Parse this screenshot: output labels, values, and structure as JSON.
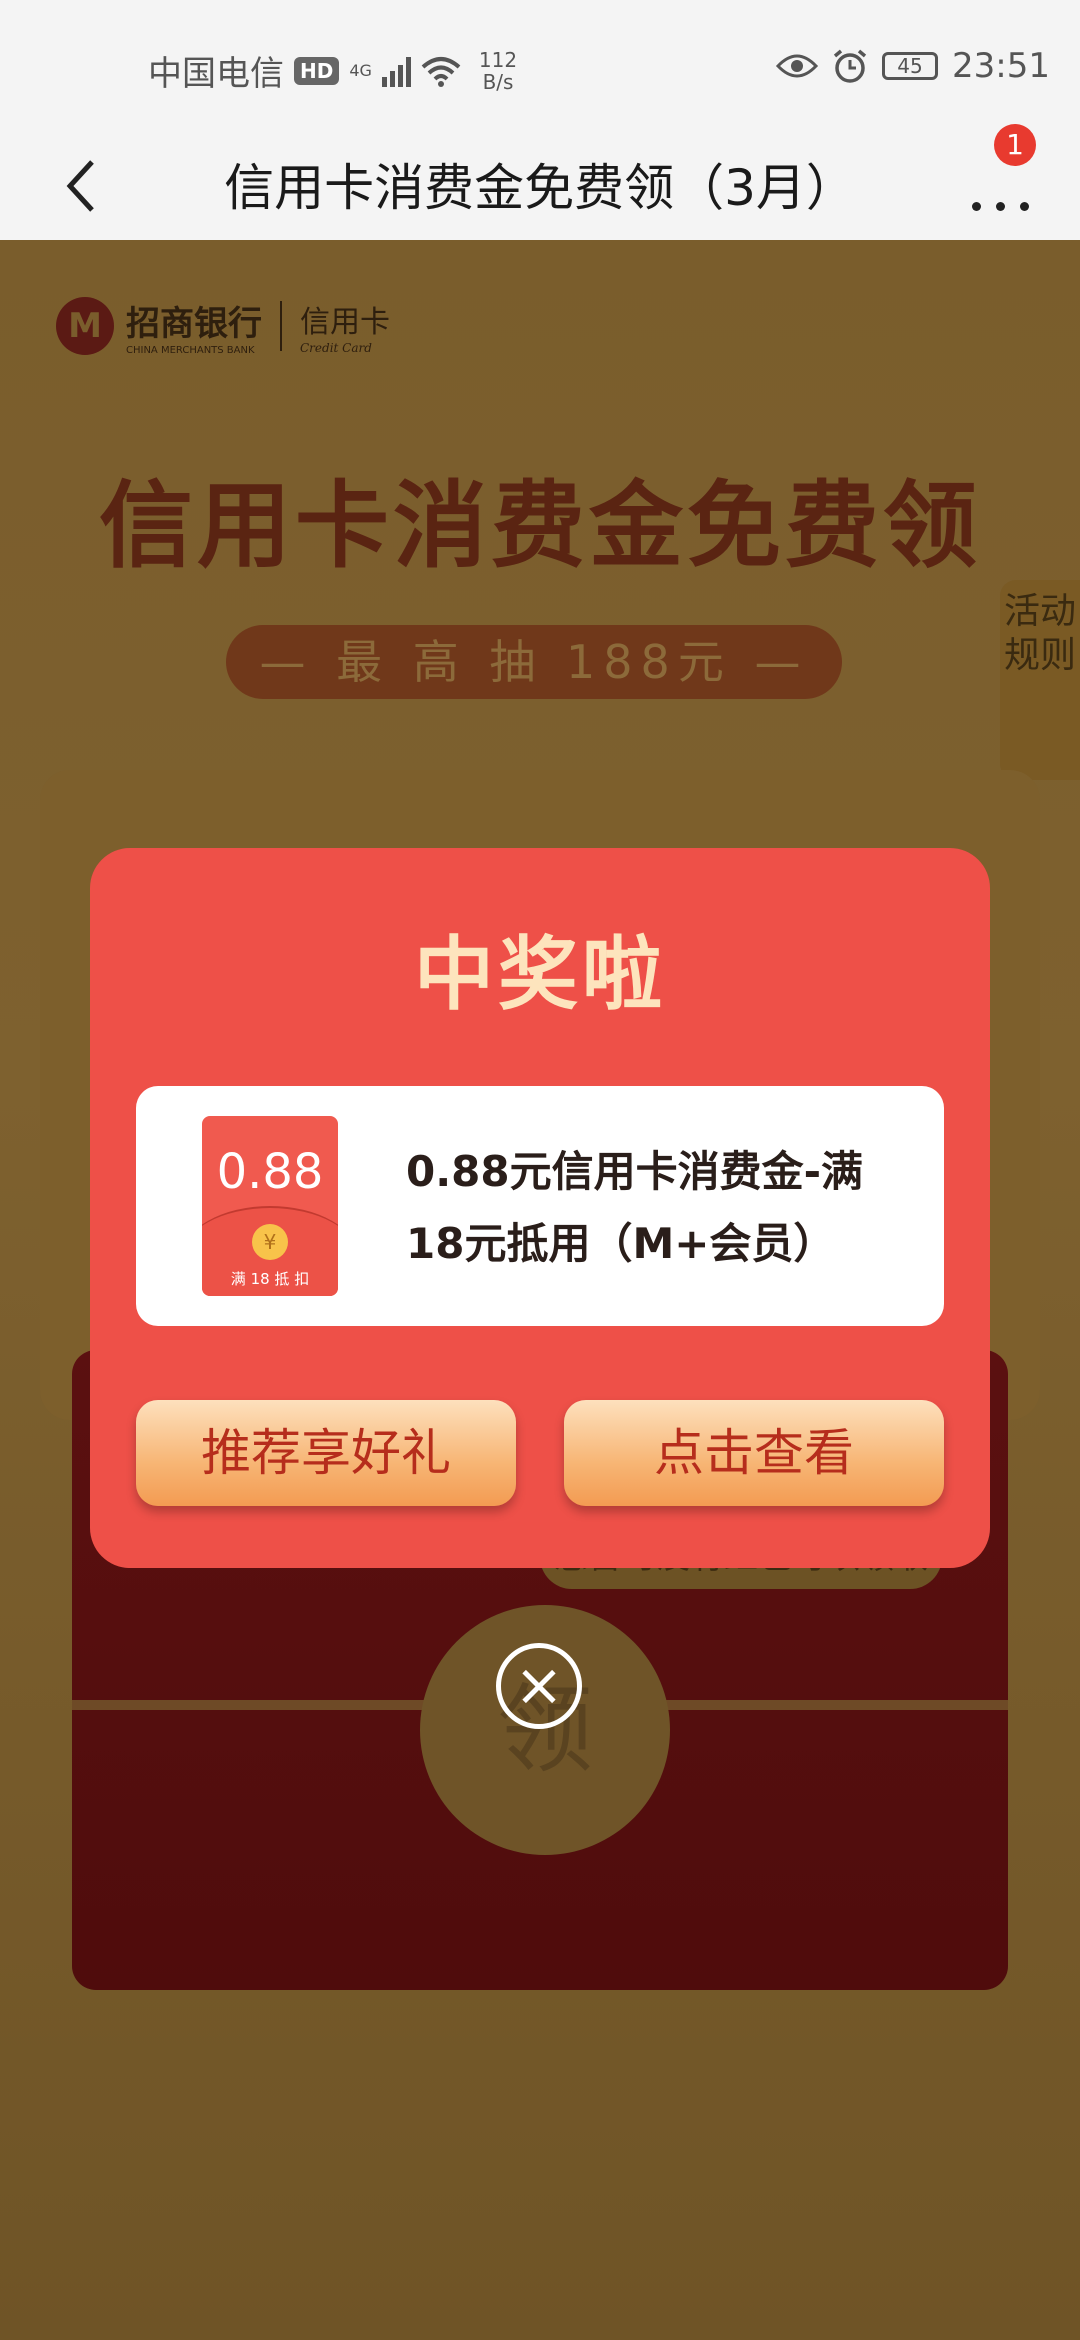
{
  "status_bar": {
    "carrier": "中国电信",
    "hd": "HD",
    "network": "4G",
    "speed_value": "112",
    "speed_unit": "B/s",
    "battery": "45",
    "time": "23:51"
  },
  "nav": {
    "title": "信用卡消费金免费领（3月）",
    "badge_count": "1"
  },
  "background_page": {
    "bank_name": "招商银行",
    "bank_name_en": "CHINA MERCHANTS BANK",
    "card_label": "信用卡",
    "card_label_en": "Credit Card",
    "hero_title": "信用卡消费金免费领",
    "hero_subtitle": "— 最 高 抽 188元 —",
    "rules_tab": "活动规则",
    "tooltip": "您暂时没有红包可以领取",
    "claim_button": "领"
  },
  "modal": {
    "title": "中奖啦",
    "envelope_amount": "0.88",
    "envelope_caption": "满 18 抵 扣",
    "prize_description": "0.88元信用卡消费金-满18元抵用（M+会员）",
    "btn_recommend": "推荐享好礼",
    "btn_view": "点击查看"
  }
}
